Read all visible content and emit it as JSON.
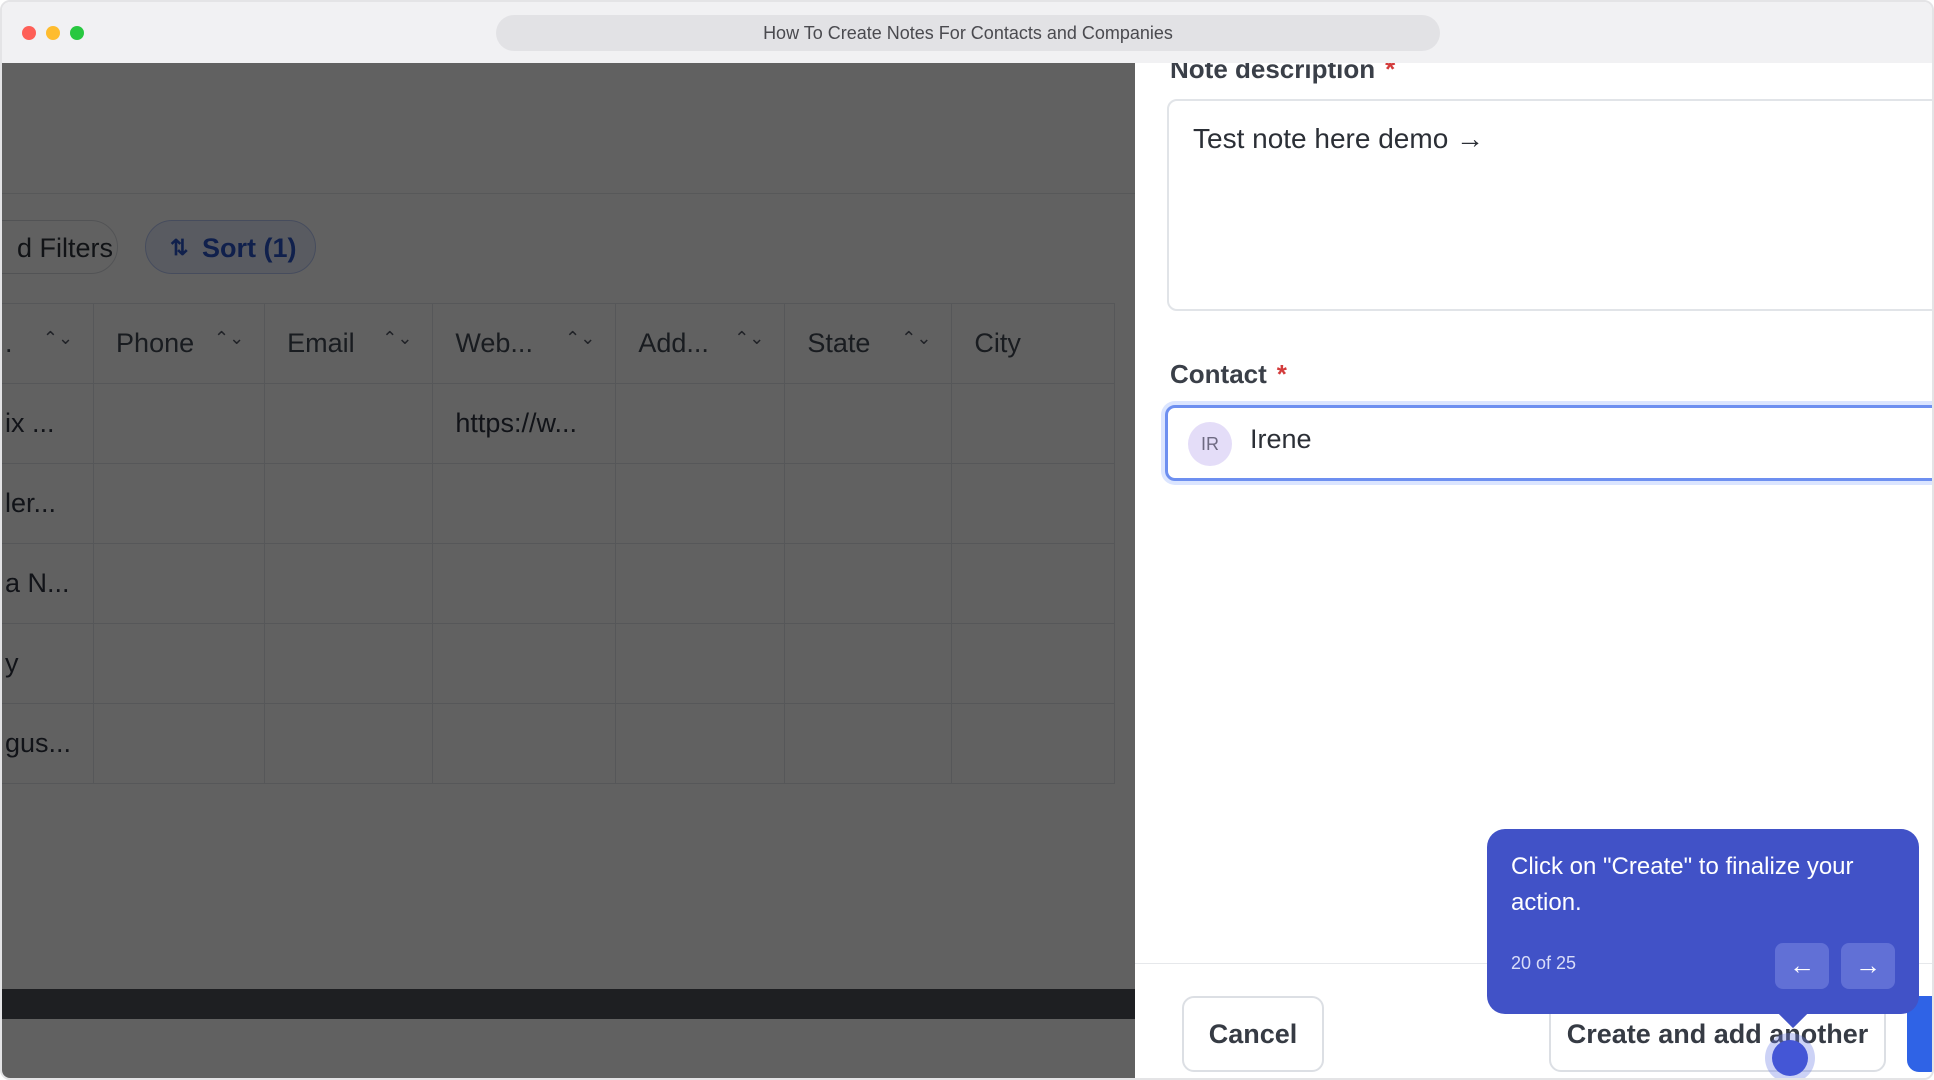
{
  "window": {
    "title": "How To Create Notes For Contacts and Companies"
  },
  "toolbar": {
    "filters_label": "d Filters",
    "sort_label": "Sort (1)",
    "sort_icon": "⇅"
  },
  "table": {
    "columns": [
      ".",
      "Phone",
      "Email",
      "Web...",
      "Add...",
      "State",
      "City"
    ],
    "rows": [
      [
        "ix ...",
        "",
        "",
        "https://w...",
        "",
        "",
        ""
      ],
      [
        "ler...",
        "",
        "",
        "",
        "",
        "",
        ""
      ],
      [
        "a N...",
        "",
        "",
        "",
        "",
        "",
        ""
      ],
      [
        "y",
        "",
        "",
        "",
        "",
        "",
        ""
      ],
      [
        "gus...",
        "",
        "",
        "",
        "",
        "",
        ""
      ]
    ]
  },
  "form": {
    "description_label": "Note description",
    "description_value": "Test note here demo →",
    "contact_label": "Contact",
    "required_mark": "*",
    "contact_initials": "IR",
    "contact_name": "Irene"
  },
  "buttons": {
    "cancel": "Cancel",
    "create_another": "Create and add another"
  },
  "tooltip": {
    "text": "Click on \"Create\" to finalize your action.",
    "step": "20 of 25",
    "prev_icon": "←",
    "next_icon": "→"
  },
  "colors": {
    "accent": "#4152c7",
    "primary_button": "#2f63e6",
    "required": "#d33b3b"
  }
}
